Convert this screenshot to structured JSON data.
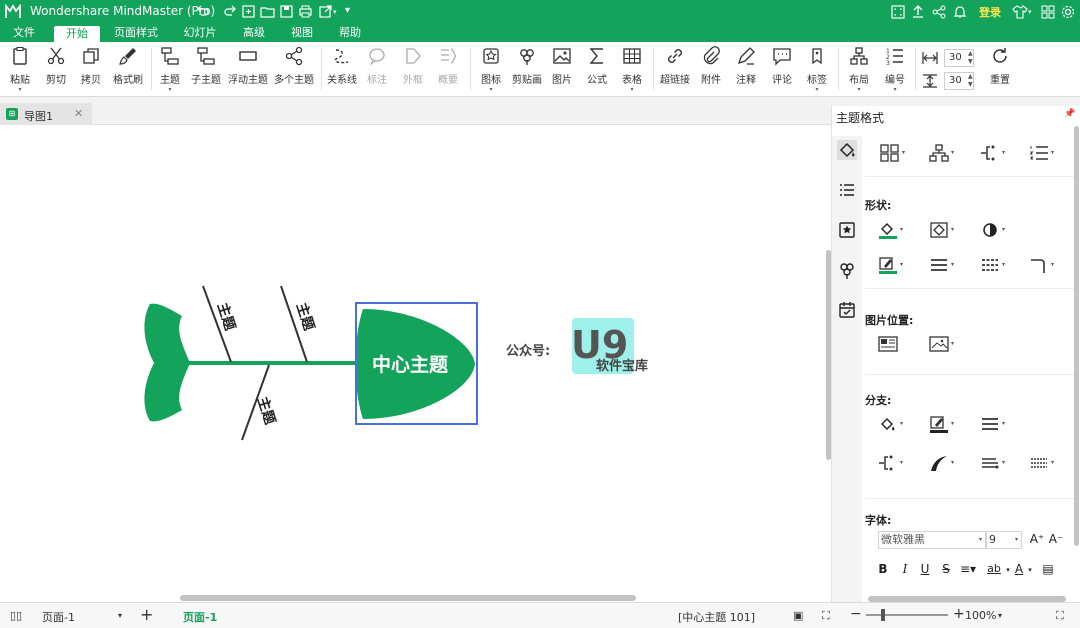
{
  "window": {
    "title": "Wondershare MindMaster (Pro)",
    "login": "登录"
  },
  "menu": {
    "items": [
      "文件",
      "开始",
      "页面样式",
      "幻灯片",
      "高级",
      "视图",
      "帮助"
    ],
    "active": "开始"
  },
  "ribbon": {
    "clipboard": [
      "粘贴",
      "剪切",
      "拷贝",
      "格式刷"
    ],
    "topics": [
      "主题",
      "子主题",
      "浮动主题",
      "多个主题"
    ],
    "annot": [
      "关系线",
      "标注",
      "外框",
      "概要"
    ],
    "insert": [
      "图标",
      "剪贴画",
      "图片",
      "公式",
      "表格"
    ],
    "links": [
      "超链接",
      "附件",
      "注释",
      "评论",
      "标签"
    ],
    "layout": [
      "布局",
      "编号"
    ],
    "spacing_h": "30",
    "spacing_v": "30",
    "reset": "重置"
  },
  "doc_tab": {
    "name": "导图1"
  },
  "canvas": {
    "center": "中心主题",
    "bones": [
      "主题",
      "主题",
      "主题"
    ],
    "watermark": {
      "prefix": "公众号:",
      "logo": "U9",
      "sub": "软件宝库"
    },
    "colors": {
      "accent": "#13a35b",
      "select": "#4a6ee0",
      "bone": "#333333",
      "watermark_bg": "#9ef0ea"
    }
  },
  "panel": {
    "title": "主题格式",
    "sections": [
      "形状:",
      "图片位置:",
      "分支:",
      "字体:"
    ],
    "font": "微软雅黑",
    "font_size": "9",
    "format_buttons": [
      "B",
      "I",
      "U",
      "S",
      "ab"
    ]
  },
  "statusbar": {
    "page_select": "页面-1",
    "page_tab": "页面-1",
    "status": "[中心主题 101]",
    "zoom": "100%"
  }
}
